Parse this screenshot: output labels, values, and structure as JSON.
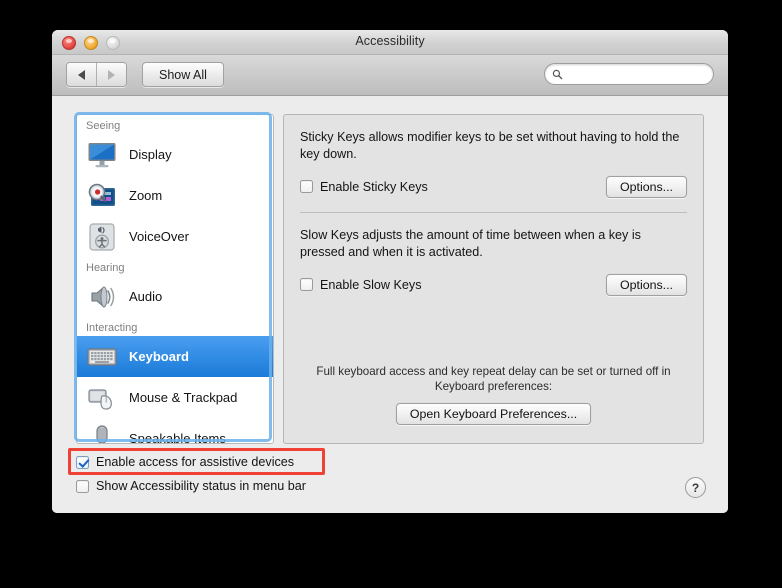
{
  "window": {
    "title": "Accessibility",
    "traffic_lights": [
      "close-button",
      "minimize-button",
      "zoom-button"
    ]
  },
  "toolbar": {
    "back_icon": "triangle-left-icon",
    "forward_icon": "triangle-right-icon",
    "show_all_label": "Show All",
    "search_placeholder": "",
    "search_value": "",
    "search_icon": "magnifier-icon"
  },
  "sidebar": {
    "groups": [
      {
        "label": "Seeing",
        "items": [
          {
            "label": "Display",
            "icon": "display-icon",
            "selected": false
          },
          {
            "label": "Zoom",
            "icon": "zoom-icon",
            "selected": false
          },
          {
            "label": "VoiceOver",
            "icon": "voiceover-icon",
            "selected": false
          }
        ]
      },
      {
        "label": "Hearing",
        "items": [
          {
            "label": "Audio",
            "icon": "audio-icon",
            "selected": false
          }
        ]
      },
      {
        "label": "Interacting",
        "items": [
          {
            "label": "Keyboard",
            "icon": "keyboard-icon",
            "selected": true
          },
          {
            "label": "Mouse & Trackpad",
            "icon": "mouse-icon",
            "selected": false
          },
          {
            "label": "Speakable Items",
            "icon": "microphone-icon",
            "selected": false
          }
        ]
      }
    ]
  },
  "panel": {
    "sticky_keys": {
      "description": "Sticky Keys allows modifier keys to be set without having to hold the key down.",
      "checkbox_label": "Enable Sticky Keys",
      "checked": false,
      "options_label": "Options..."
    },
    "slow_keys": {
      "description": "Slow Keys adjusts the amount of time between when a key is pressed and when it is activated.",
      "checkbox_label": "Enable Slow Keys",
      "checked": false,
      "options_label": "Options..."
    },
    "footnote": {
      "text": "Full keyboard access and key repeat delay can be set or turned off in Keyboard preferences:",
      "button_label": "Open Keyboard Preferences..."
    }
  },
  "bottom": {
    "assistive_devices": {
      "label": "Enable access for assistive devices",
      "checked": true,
      "highlighted": true
    },
    "menu_bar_status": {
      "label": "Show Accessibility status in menu bar",
      "checked": false
    },
    "help_label": "?"
  },
  "colors": {
    "selection_blue": "#1a7bd8",
    "annotation_red": "#ef4136",
    "window_background": "#ececec",
    "panel_background": "#e3e3e3",
    "desktop_background": "#000000"
  }
}
